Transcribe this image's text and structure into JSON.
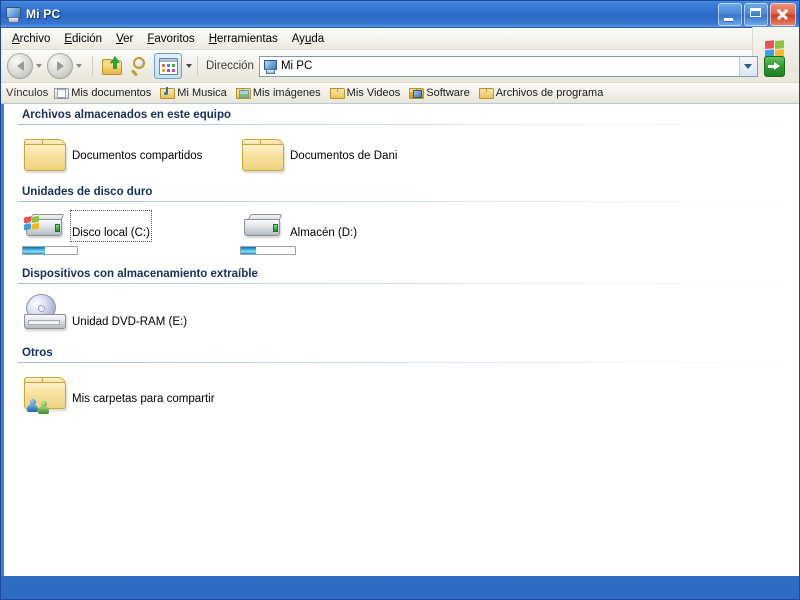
{
  "window": {
    "title": "Mi PC",
    "title_icon": "my-computer-icon",
    "buttons": {
      "minimize": "minimize-button",
      "maximize": "maximize-button",
      "close": "close-button"
    }
  },
  "menubar": {
    "items": [
      {
        "label": "Archivo",
        "accel": "A"
      },
      {
        "label": "Edición",
        "accel": "E"
      },
      {
        "label": "Ver",
        "accel": "V"
      },
      {
        "label": "Favoritos",
        "accel": "F"
      },
      {
        "label": "Herramientas",
        "accel": "H"
      },
      {
        "label": "Ayuda",
        "accel": "u"
      }
    ],
    "brand_icon": "windows-flag-icon"
  },
  "toolbar": {
    "back": "Atrás",
    "forward": "Adelante",
    "up": "Arriba",
    "search": "Búsqueda",
    "views": "Vistas",
    "address_label": "Dirección",
    "address_value": "Mi PC",
    "address_icon": "my-computer-icon",
    "go_label": "Ir"
  },
  "linksbar": {
    "label": "Vínculos",
    "items": [
      {
        "label": "Mis documentos",
        "icon": "documents-folder-icon"
      },
      {
        "label": "Mi Musica",
        "icon": "music-folder-icon"
      },
      {
        "label": "Mis imágenes",
        "icon": "pictures-folder-icon"
      },
      {
        "label": "Mis Videos",
        "icon": "folder-icon"
      },
      {
        "label": "Software",
        "icon": "software-folder-icon"
      },
      {
        "label": "Archivos de programa",
        "icon": "folder-icon"
      }
    ]
  },
  "groups": [
    {
      "header": "Archivos almacenados en este equipo",
      "items": [
        {
          "label": "Documentos compartidos",
          "icon": "folder-icon",
          "type": "folder",
          "focused": false
        },
        {
          "label": "Documentos de Dani",
          "icon": "folder-icon",
          "type": "folder",
          "focused": false
        }
      ]
    },
    {
      "header": "Unidades de disco duro",
      "items": [
        {
          "label": "Disco local (C:)",
          "icon": "hard-drive-icon",
          "type": "drive",
          "focused": true,
          "capacity_percent": 40,
          "system": true
        },
        {
          "label": "Almacén (D:)",
          "icon": "hard-drive-icon",
          "type": "drive",
          "focused": false,
          "capacity_percent": 28,
          "system": false
        }
      ]
    },
    {
      "header": "Dispositivos con almacenamiento extraíble",
      "items": [
        {
          "label": "Unidad DVD-RAM (E:)",
          "icon": "dvd-drive-icon",
          "type": "optical",
          "focused": false
        }
      ]
    },
    {
      "header": "Otros",
      "items": [
        {
          "label": "Mis carpetas para compartir",
          "icon": "shared-folder-icon",
          "type": "shared",
          "focused": false
        }
      ]
    }
  ],
  "colors": {
    "title_blue": "#2f6fcd",
    "accent_border": "#4a7fc8",
    "group_header": "#17305a",
    "close_red": "#cf3c1e",
    "go_green": "#2f9c31",
    "capacity_blue": "#3fb7e8"
  }
}
